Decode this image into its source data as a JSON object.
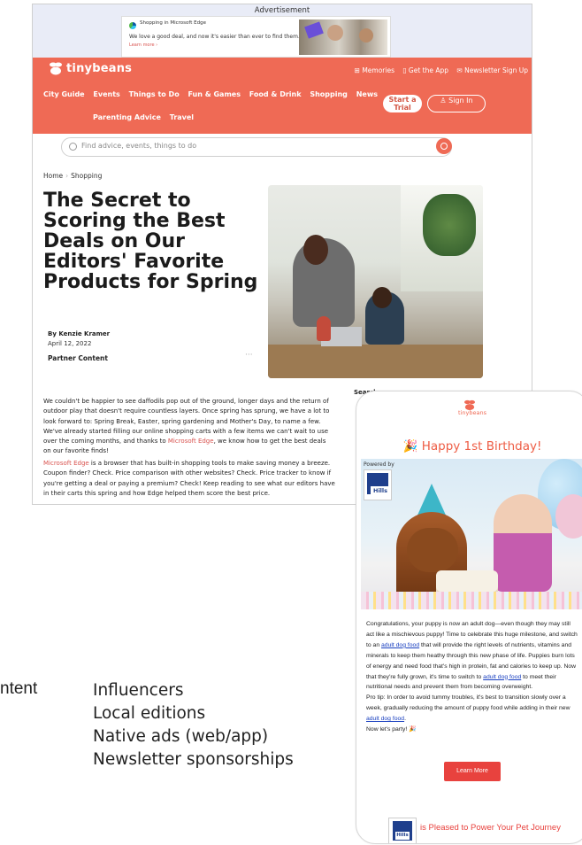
{
  "ad": {
    "label": "Advertisement",
    "brand": "Shopping in Microsoft Edge",
    "text": "We love a good deal, and now it's easier than ever to find them.",
    "link": "Learn more ›"
  },
  "site": {
    "logo": "tinybeans",
    "top_links": [
      "Memories",
      "Get the App",
      "Newsletter Sign Up"
    ],
    "nav_row1": [
      "City Guide",
      "Events",
      "Things to Do",
      "Fun & Games",
      "Food & Drink",
      "Shopping",
      "News"
    ],
    "nav_row2": [
      "Parenting Advice",
      "Travel"
    ],
    "start_trial": "Start a Trial",
    "sign_in": "Sign In",
    "search_placeholder": "Find advice, events, things to do",
    "breadcrumb": {
      "home": "Home",
      "section": "Shopping",
      "sep": "›"
    },
    "title": "The Secret to Scoring the Best Deals on Our Editors' Favorite Products for Spring",
    "author": "By Kenzie Kramer",
    "date": "April 12, 2022",
    "partner": "Partner Content",
    "more": "···",
    "para1_a": "We couldn't be happier to see daffodils pop out of the ground, longer days and the return of outdoor play that doesn't require countless layers. Once spring has sprung, we have a lot to look forward to: Spring Break, Easter, spring gardening and Mother's Day, to name a few. We've already started filling our online shopping carts with a few items we can't wait to use over the coming months, and thanks to ",
    "para1_link": "Microsoft Edge",
    "para1_b": ", we know how to get the best deals on our favorite finds!",
    "para2_link": "Microsoft Edge",
    "para2_b": " is a browser that has built-in shopping tools to make saving money a breeze. Coupon finder? Check. Price comparison with other websites? Check. Price tracker to know if you're getting a deal or paying a premium? Check! Keep reading to see what our editors have in their carts this spring and how Edge helped them score the best price.",
    "sidebar_search": "Search m"
  },
  "email": {
    "logo": "tinybeans",
    "headline": "🎉 Happy 1st Birthday!",
    "powered_by": "Powered by",
    "hills": "Hills",
    "body_1": "Congratulations, your puppy is now an adult dog—even though they may still act like a mischievous puppy! Time to celebrate this huge milestone, and switch to an ",
    "link_1": "adult dog food",
    "body_2": " that will provide the right levels of nutrients, vitamins and minerals to keep them heathy through this new phase of life. Puppies burn lots of energy and need food that's high in protein, fat and calories to keep up. Now that they're fully grown, it's time to switch to ",
    "link_2": "adult dog food",
    "body_3": " to meet their nutritional needs and prevent them from becoming overweight.",
    "body_4": "Pro tip: In order to avoid tummy troubles, it's best to transition slowly over a week, gradually reducing the amount of puppy food while adding in their new ",
    "link_3": "adult dog food",
    "body_5": ".",
    "body_6": "Now let's party! 🎉",
    "button": "Learn More",
    "footer": "is Pleased to Power Your Pet Journey"
  },
  "slide": {
    "left_text": "ntent",
    "items": [
      "Influencers",
      "Local editions",
      "Native ads (web/app)",
      "Newsletter sponsorships"
    ]
  },
  "colors": {
    "brand": "#ef6a55",
    "email_accent": "#e8423e",
    "hills_blue": "#1f3f8c"
  }
}
